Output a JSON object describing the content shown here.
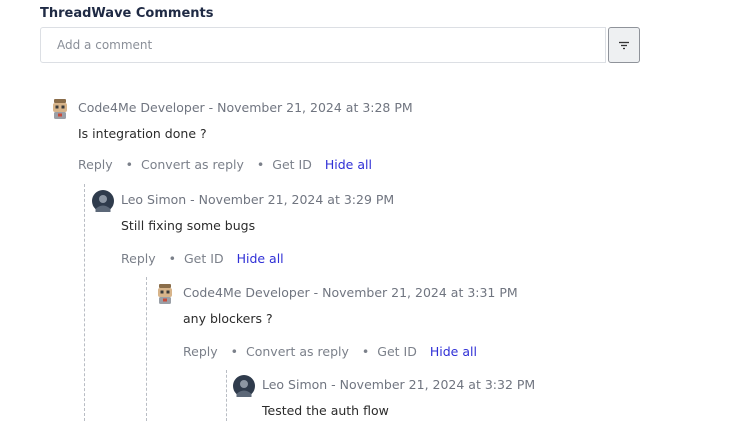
{
  "app": {
    "title": "ThreadWave Comments"
  },
  "composer": {
    "placeholder": "Add a comment",
    "filter_icon": "filter-icon"
  },
  "comments": [
    {
      "author": "Code4Me Developer",
      "meta": "Code4Me Developer - November 21, 2024 at 3:28 PM",
      "text": "Is integration done ?",
      "avatar": "robot-avatar",
      "actions": {
        "reply": "Reply",
        "convert": "Convert as reply",
        "get_id": "Get ID",
        "hide": "Hide all"
      }
    },
    {
      "author": "Leo Simon",
      "meta": "Leo Simon - November 21, 2024 at 3:29 PM",
      "text": "Still fixing some bugs",
      "avatar": "user-photo-avatar",
      "actions": {
        "reply": "Reply",
        "get_id": "Get ID",
        "hide": "Hide all"
      }
    },
    {
      "author": "Code4Me Developer",
      "meta": "Code4Me Developer - November 21, 2024 at 3:31 PM",
      "text": "any blockers ?",
      "avatar": "robot-avatar",
      "actions": {
        "reply": "Reply",
        "convert": "Convert as reply",
        "get_id": "Get ID",
        "hide": "Hide all"
      }
    },
    {
      "author": "Leo Simon",
      "meta": "Leo Simon - November 21, 2024 at 3:32 PM",
      "text": "Tested the auth flow",
      "avatar": "user-photo-avatar"
    }
  ],
  "colors": {
    "link": "#2f2fd6",
    "muted": "#707580",
    "title": "#1f2a44",
    "thread_line": "#b9bdc4"
  }
}
